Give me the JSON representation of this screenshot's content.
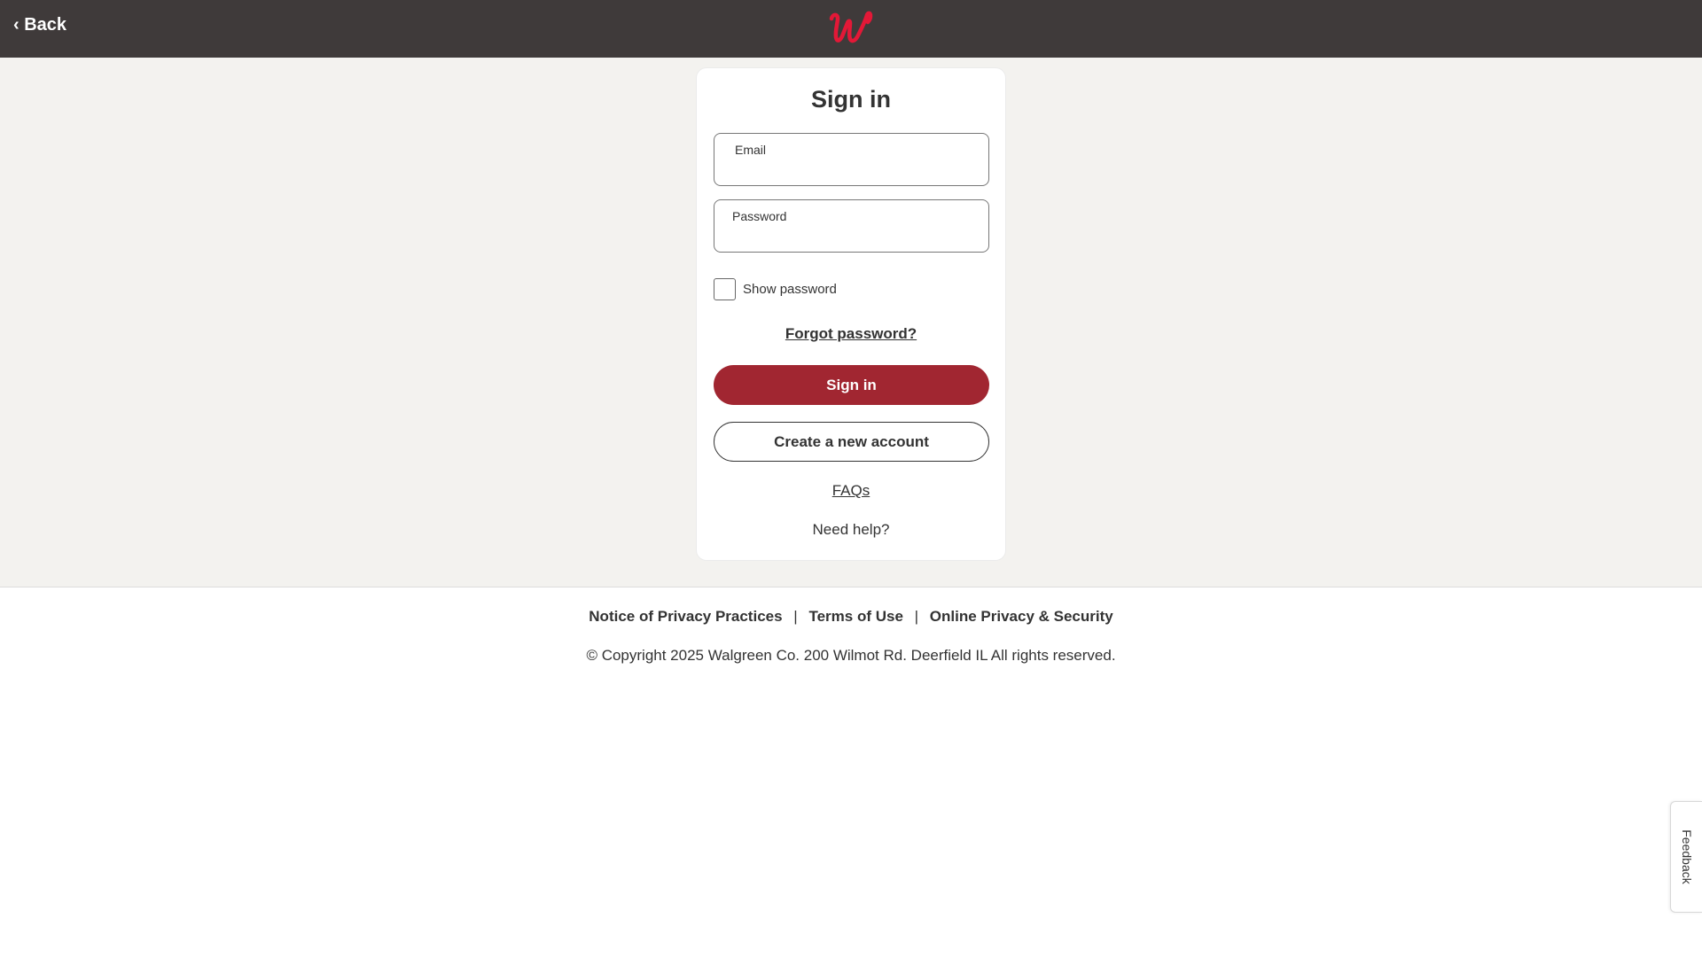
{
  "header": {
    "back_label": "‹ Back",
    "logo_icon": "walgreens-w-logo-icon",
    "brand_color": "#e31837",
    "bar_color": "#3f3a3a"
  },
  "signin": {
    "title": "Sign in",
    "email": {
      "label": "Email",
      "value": ""
    },
    "password": {
      "label": "Password",
      "value": ""
    },
    "show_password_label": "Show password",
    "show_password_checked": false,
    "forgot_label": "Forgot password?",
    "signin_button": "Sign in",
    "signin_button_color": "#a12631",
    "create_button": "Create a new account",
    "faqs_label": "FAQs",
    "need_help": "Need help?"
  },
  "footer": {
    "links": [
      "Notice of Privacy Practices",
      "Terms of Use",
      "Online Privacy & Security"
    ],
    "separator": "|",
    "copyright": "© Copyright 2025 Walgreen Co. 200 Wilmot Rd. Deerfield IL All rights reserved."
  },
  "feedback_tab": {
    "label": "Feedback"
  }
}
